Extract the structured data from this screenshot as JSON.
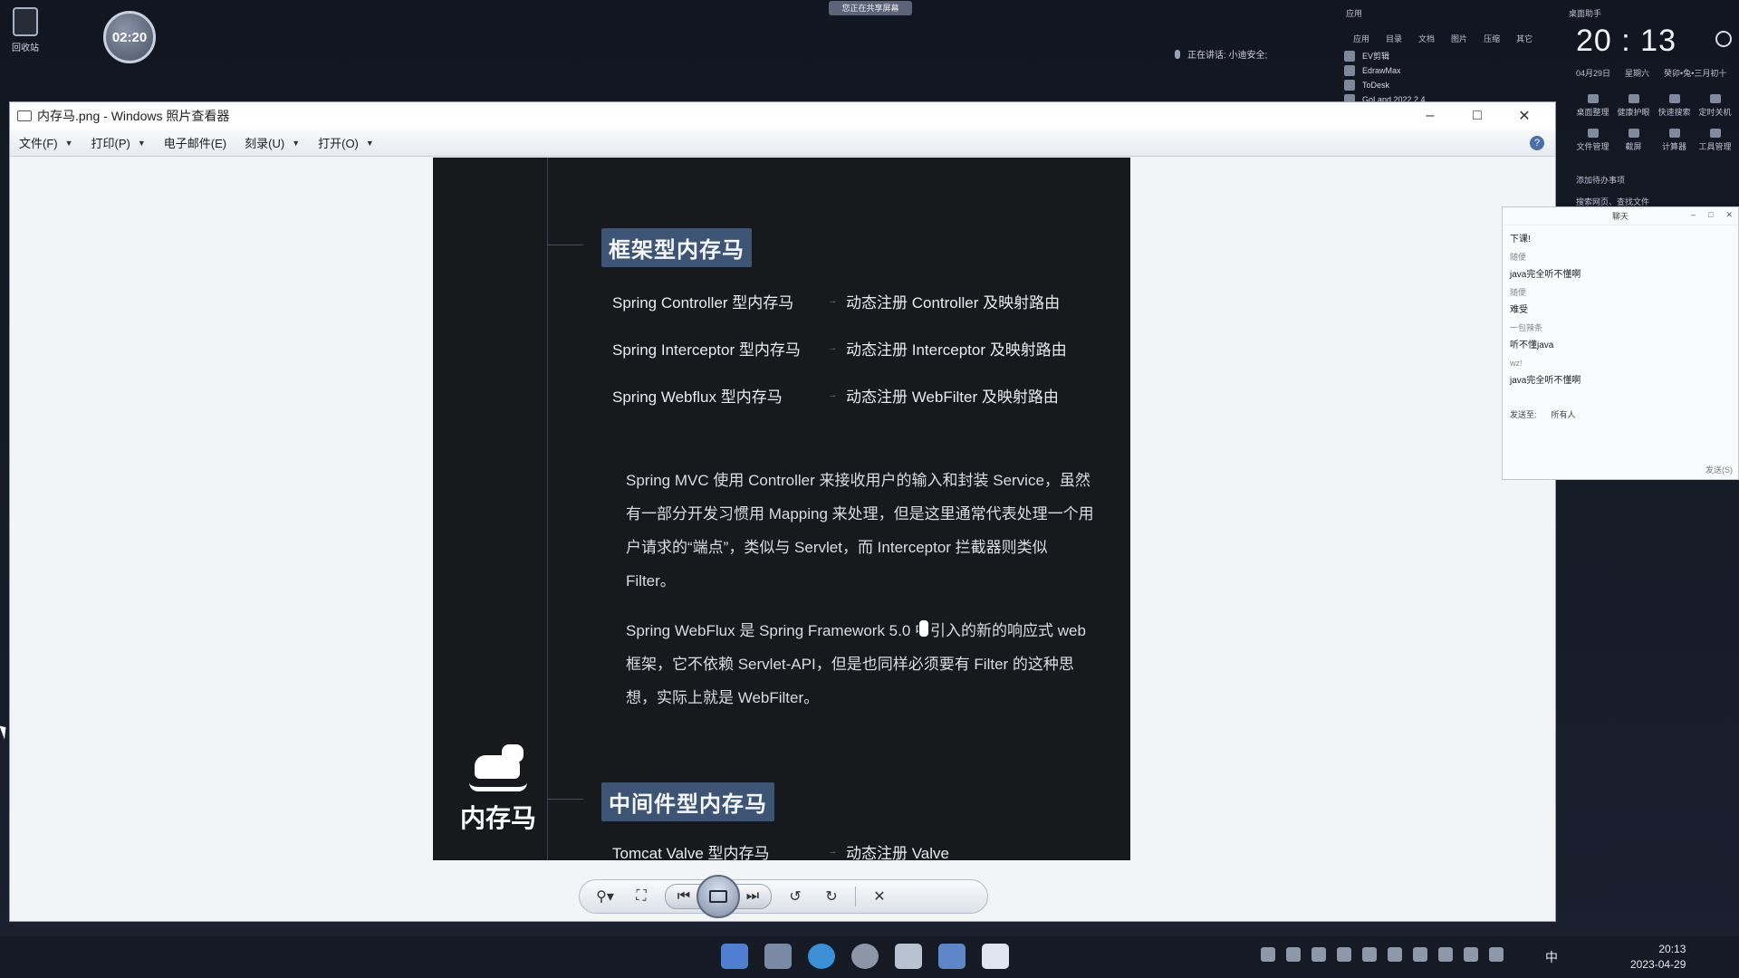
{
  "desktop": {
    "recycle_bin_label": "回收站",
    "recording_timer": "02:20",
    "share_banner": "您正在共享屏幕",
    "speaker_info": "正在讲话: 小迪安全;"
  },
  "app_panel": {
    "header": "应用",
    "tabs": [
      "应用",
      "目录",
      "文档",
      "图片",
      "压缩",
      "其它"
    ],
    "apps": [
      "EV剪辑",
      "EdrawMax",
      "ToDesk",
      "GoLand 2022.2.4"
    ]
  },
  "assistant": {
    "title": "桌面助手",
    "clock": "20 : 13",
    "date": "04月29日",
    "weekday": "星期六",
    "lunar": "癸卯•兔•三月初十",
    "tools": [
      "桌面整理",
      "健康护眼",
      "快速搜索",
      "定时关机",
      "文件管理",
      "截屏",
      "计算器",
      "工具管理"
    ],
    "todo": "添加待办事项",
    "search": "搜索网页、查找文件"
  },
  "viewer": {
    "title": "内存马.png - Windows 照片查看器",
    "menu": [
      {
        "label": "文件(F)",
        "caret": true
      },
      {
        "label": "打印(P)",
        "caret": true
      },
      {
        "label": "电子邮件(E)",
        "caret": false
      },
      {
        "label": "刻录(U)",
        "caret": true
      },
      {
        "label": "打开(O)",
        "caret": true
      }
    ],
    "help": "?"
  },
  "image": {
    "section1_title": "框架型内存马",
    "rows": [
      {
        "left": "Spring Controller 型内存马",
        "right": "动态注册 Controller 及映射路由"
      },
      {
        "left": "Spring Interceptor 型内存马",
        "right": "动态注册 Interceptor 及映射路由"
      },
      {
        "left": "Spring Webflux 型内存马",
        "right": "动态注册 WebFilter 及映射路由"
      }
    ],
    "para1": "Spring MVC 使用 Controller 来接收用户的输入和封装 Service，虽然有一部分开发习惯用 Mapping 来处理，但是这里通常代表处理一个用户请求的“端点”，类似与 Servlet，而 Interceptor 拦截器则类似 Filter。",
    "para2": "Spring WebFlux 是 Spring Framework 5.0 中引入的新的响应式 web 框架，它不依赖 Servlet-API，但是也同样必须要有 Filter 的这种思想，实际上就是 WebFilter。",
    "section2_title": "中间件型内存马",
    "row4": {
      "left": "Tomcat Valve 型内存马",
      "right": "动态注册 Valve"
    },
    "logo_text": "内存马"
  },
  "chat": {
    "title": "聊天",
    "messages": [
      {
        "text": "下课!",
        "type": "msg"
      },
      {
        "text": "随便",
        "type": "sender"
      },
      {
        "text": "java完全听不懂啊",
        "type": "msg"
      },
      {
        "text": "随便",
        "type": "sender"
      },
      {
        "text": "难受",
        "type": "msg"
      },
      {
        "text": "一包辣条",
        "type": "sender"
      },
      {
        "text": "听不懂java",
        "type": "msg"
      },
      {
        "text": "wz!",
        "type": "sender"
      },
      {
        "text": "java完全听不懂啊",
        "type": "msg"
      }
    ],
    "send_to_label": "发送至:",
    "send_to_value": "所有人",
    "send_button": "发送(S)"
  },
  "taskbar": {
    "ime": "中",
    "time": "20:13",
    "date": "2023-04-29"
  }
}
